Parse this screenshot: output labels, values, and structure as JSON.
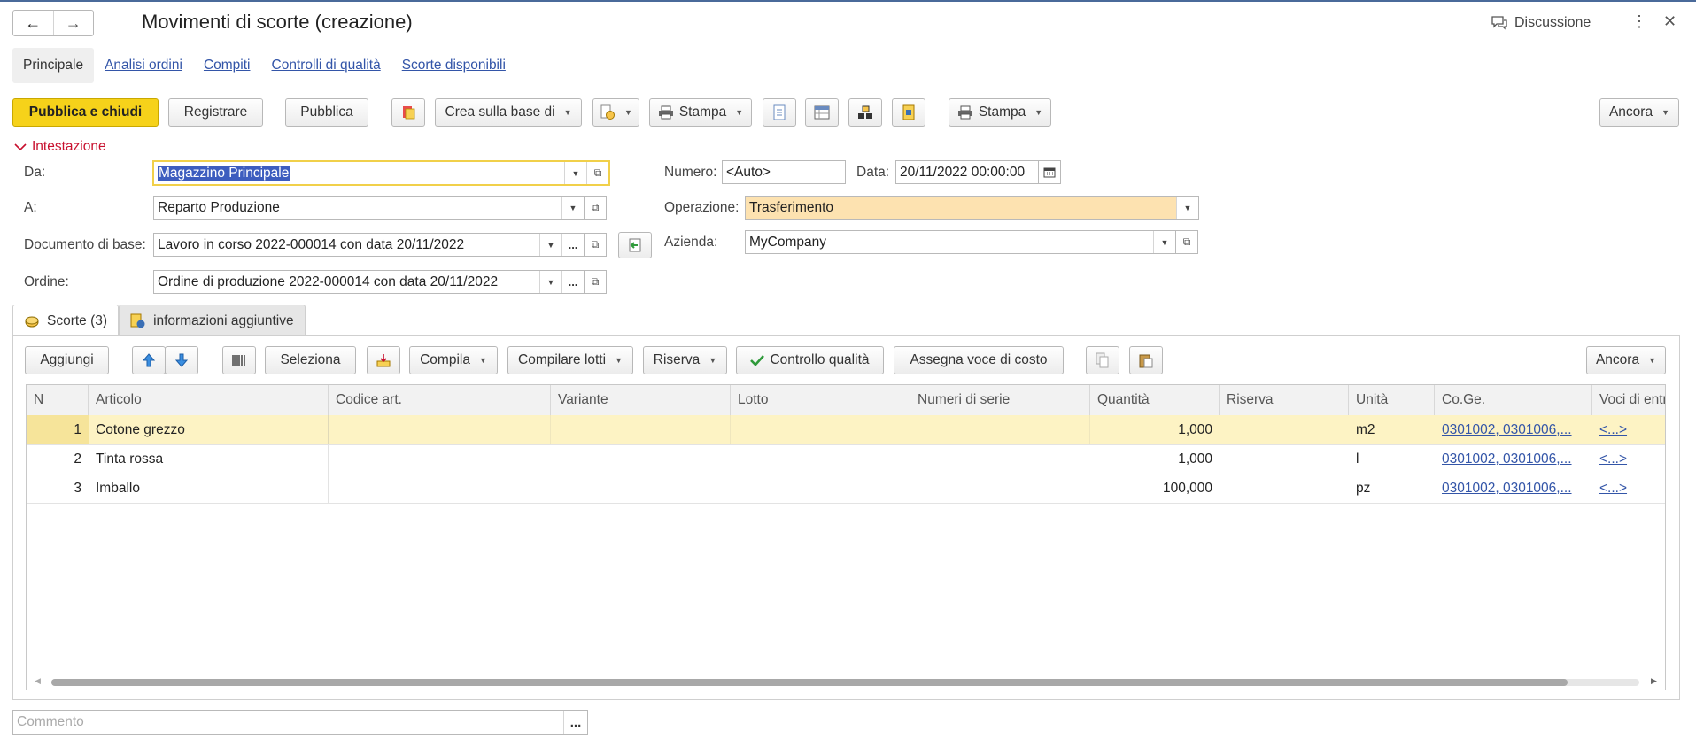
{
  "window": {
    "title": "Movimenti di scorte (creazione)",
    "discussion": "Discussione",
    "more_icon": "kebab-icon",
    "close_icon": "close-icon"
  },
  "tabs": [
    "Principale",
    "Analisi ordini",
    "Compiti",
    "Controlli di qualità",
    "Scorte disponibili"
  ],
  "toolbar": {
    "publish_close": "Pubblica e chiudi",
    "register": "Registrare",
    "publish": "Pubblica",
    "create_based": "Crea sulla base di",
    "print1": "Stampa",
    "print2": "Stampa",
    "more": "Ancora"
  },
  "section": {
    "header": "Intestazione"
  },
  "form": {
    "from_label": "Da:",
    "from_value": "Magazzino Principale",
    "to_label": "A:",
    "to_value": "Reparto Produzione",
    "base_label": "Documento di base:",
    "base_value": "Lavoro in corso 2022-000014 con data 20/11/2022",
    "order_label": "Ordine:",
    "order_value": "Ordine di produzione 2022-000014 con data 20/11/2022",
    "number_label": "Numero:",
    "number_placeholder": "<Auto>",
    "date_label": "Data:",
    "date_value": "20/11/2022 00:00:00",
    "operation_label": "Operazione:",
    "operation_value": "Trasferimento",
    "company_label": "Azienda:",
    "company_value": "MyCompany"
  },
  "bottom_tabs": [
    "Scorte (3)",
    "informazioni aggiuntive"
  ],
  "table_toolbar": {
    "add": "Aggiungi",
    "select": "Seleziona",
    "fill": "Compila",
    "fill_lots": "Compilare lotti",
    "reserve": "Riserva",
    "quality": "Controllo qualità",
    "cost_item": "Assegna voce di costo",
    "more": "Ancora"
  },
  "table": {
    "columns": [
      "N",
      "Articolo",
      "Codice art.",
      "Variante",
      "Lotto",
      "Numeri di serie",
      "Quantità",
      "Riserva",
      "Unità",
      "Co.Ge.",
      "Voci di entr"
    ],
    "rows": [
      {
        "n": "1",
        "article": "Cotone grezzo",
        "code": "",
        "variant": "",
        "lot": "",
        "serials": "",
        "qty": "1,000",
        "reserve": "",
        "unit": "m2",
        "gl": "0301002, 0301006,...",
        "items": "<...>"
      },
      {
        "n": "2",
        "article": "Tinta rossa",
        "code": "",
        "variant": "",
        "lot": "",
        "serials": "",
        "qty": "1,000",
        "reserve": "",
        "unit": "l",
        "gl": "0301002, 0301006,...",
        "items": "<...>"
      },
      {
        "n": "3",
        "article": "Imballo",
        "code": "",
        "variant": "",
        "lot": "",
        "serials": "",
        "qty": "100,000",
        "reserve": "",
        "unit": "pz",
        "gl": "0301002, 0301006,...",
        "items": "<...>"
      }
    ]
  },
  "comment": {
    "placeholder": "Commento"
  },
  "colors": {
    "accent": "#f6d21a",
    "link": "#3355a8",
    "section": "#c8102e",
    "selected_row": "#fdf3c4",
    "operation_bg": "#fde2b0"
  }
}
